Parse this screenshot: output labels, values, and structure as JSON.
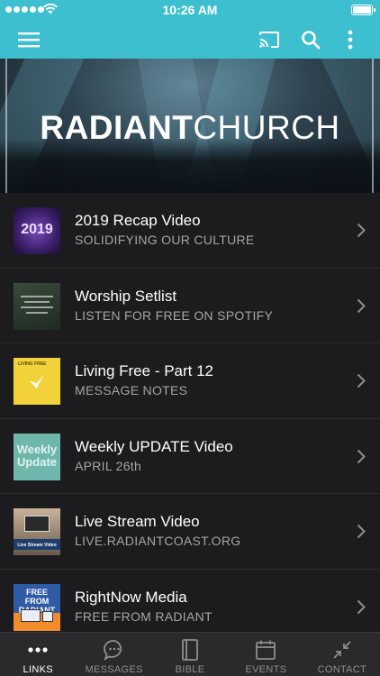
{
  "status_bar": {
    "time": "10:26 AM"
  },
  "nav": {
    "colors": {
      "accent": "#3ebfcf"
    },
    "icons": [
      "menu-icon",
      "cast-icon",
      "search-icon",
      "more-vertical-icon"
    ]
  },
  "hero": {
    "title_bold": "RADIANT",
    "title_light": "CHURCH"
  },
  "items": [
    {
      "title": "2019 Recap Video",
      "subtitle": "SOLIDIFYING OUR CULTURE",
      "thumb_text": "2019"
    },
    {
      "title": "Worship Setlist",
      "subtitle": "LISTEN FOR FREE ON SPOTIFY"
    },
    {
      "title": "Living Free - Part 12",
      "subtitle": "MESSAGE NOTES",
      "thumb_text": "LIVING FREE"
    },
    {
      "title": "Weekly UPDATE Video",
      "subtitle": "APRIL 26th",
      "thumb_text": "Weekly Update"
    },
    {
      "title": "Live Stream Video",
      "subtitle": "LIVE.RADIANTCOAST.ORG",
      "thumb_text": "Live Stream Video"
    },
    {
      "title": "RightNow Media",
      "subtitle": "FREE FROM RADIANT",
      "thumb_text": "FREE FROM RADIANT"
    }
  ],
  "tabs": [
    {
      "label": "LINKS",
      "icon": "more-horizontal-icon",
      "active": true
    },
    {
      "label": "MESSAGES",
      "icon": "chat-bubble-icon",
      "active": false
    },
    {
      "label": "BIBLE",
      "icon": "book-icon",
      "active": false
    },
    {
      "label": "EVENTS",
      "icon": "calendar-icon",
      "active": false
    },
    {
      "label": "CONTACT",
      "icon": "collapse-arrows-icon",
      "active": false
    }
  ]
}
